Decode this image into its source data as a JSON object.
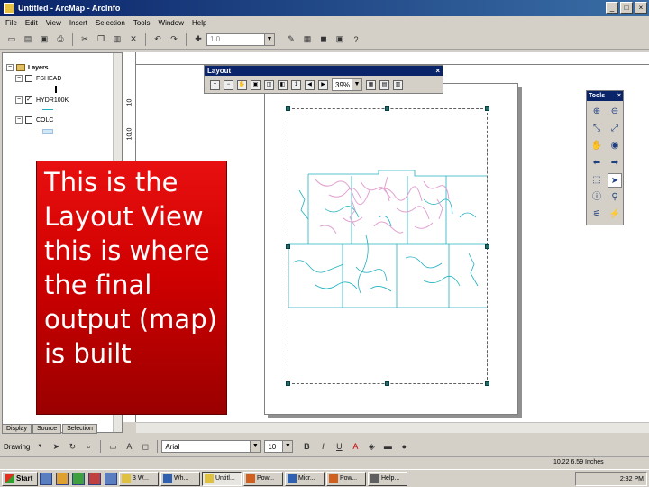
{
  "window": {
    "title": "Untitled - ArcMap - ArcInfo",
    "minimize": "_",
    "maximize": "□",
    "close": "×"
  },
  "menu": [
    "File",
    "Edit",
    "View",
    "Insert",
    "Selection",
    "Tools",
    "Window",
    "Help"
  ],
  "toolbar": {
    "scale_value": "1:0"
  },
  "toc": {
    "root_label": "Layers",
    "layers": [
      {
        "name": "FSHEAD"
      },
      {
        "name": "HYDR100K"
      },
      {
        "name": "COLC"
      }
    ],
    "tabs": [
      "Display",
      "Source",
      "Selection"
    ]
  },
  "ruler": {
    "v_labels": [
      "10",
      "10",
      "10"
    ]
  },
  "layout_toolbar": {
    "title": "Layout",
    "zoom_value": "39%"
  },
  "tools_toolbar": {
    "title": "Tools"
  },
  "callout": {
    "text": "This is the Layout View this is where the final output (map) is built"
  },
  "drawing": {
    "label": "Drawing",
    "font_name": "Arial",
    "font_size": "10"
  },
  "status": {
    "coords": "10.22  6.59 Inches"
  },
  "taskbar": {
    "start": "Start",
    "items": [
      "3 W...",
      "Wh...",
      "Untitl...",
      "Pow...",
      "Micr...",
      "Pow...",
      "Help..."
    ],
    "clock": "2:32 PM"
  },
  "colors": {
    "accent": "#0a246a",
    "callout_red": "#d00000",
    "map_blue": "#20b0c0",
    "map_pink": "#e0a0d0"
  }
}
